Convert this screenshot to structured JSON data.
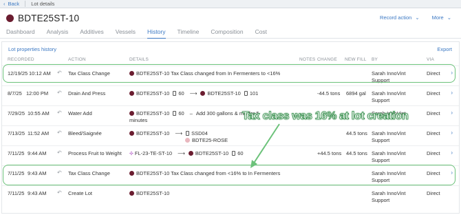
{
  "topbar": {
    "back_label": "Back",
    "breadcrumb": "Lot details"
  },
  "lot": {
    "name": "BDTE25ST-10",
    "color": "#6b1d30"
  },
  "actions": {
    "record_action": "Record action",
    "more": "More"
  },
  "tabs": [
    "Dashboard",
    "Analysis",
    "Additives",
    "Vessels",
    "History",
    "Timeline",
    "Composition",
    "Cost"
  ],
  "active_tab": "History",
  "section": {
    "title": "Lot properties history",
    "export": "Export"
  },
  "columns": {
    "recorded": "RECORDED",
    "action": "ACTION",
    "details": "DETAILS",
    "notes": "NOTES",
    "change": "CHANGE",
    "new_fill": "NEW FILL",
    "by": "BY",
    "via": "VIA"
  },
  "rows": [
    {
      "date": "12/19/25",
      "time": "10:12 AM",
      "action": "Tax Class Change",
      "details": "BDTE25ST-10 Tax Class changed from In Fermenters to <16%",
      "change": "",
      "new_fill": "",
      "by": "Sarah InnoVint Support",
      "via": "Direct"
    },
    {
      "date": "8/7/25",
      "time": "12:00 PM",
      "action": "Drain And Press",
      "from_lot": "BDTE25ST-10",
      "from_vessel": "60",
      "to_lot": "BDTE25ST-10",
      "to_vessel": "101",
      "change": "-44.5 tons",
      "new_fill": "6894 gal",
      "by": "Sarah InnoVint Support",
      "via": "Direct"
    },
    {
      "date": "7/29/25",
      "time": "10:55 AM",
      "action": "Water Add",
      "lot": "BDTE25ST-10",
      "vessel": "60",
      "note": "Add 300 gallons & mix for 5",
      "note_cont": "minutes",
      "change": "",
      "new_fill": "",
      "by": "Sarah InnoVint",
      "via": "Direct"
    },
    {
      "date": "7/13/25",
      "time": "11:52 AM",
      "action": "Bleed/Saignée",
      "from_lot": "BDTE25ST-10",
      "to_vessel": "SSD04",
      "to_lot": "BDTE25-ROSE",
      "change": "",
      "new_fill": "44.5 tons",
      "by": "Sarah InnoVint Support",
      "via": "Direct"
    },
    {
      "date": "7/11/25",
      "time": "9:44 AM",
      "action": "Process Fruit to Weight",
      "from_lot": "FL-23-TE-ST-10",
      "to_lot": "BDTE25ST-10",
      "to_vessel": "60",
      "change": "+44.5 tons",
      "new_fill": "44.5 tons",
      "by": "Sarah InnoVint Support",
      "via": "Direct"
    },
    {
      "date": "7/11/25",
      "time": "9:43 AM",
      "action": "Tax Class Change",
      "details": "BDTE25ST-10 Tax Class changed from <16% to In Fermenters",
      "change": "",
      "new_fill": "",
      "by": "Sarah InnoVint Support",
      "via": "Direct"
    },
    {
      "date": "7/11/25",
      "time": "9:43 AM",
      "action": "Create Lot",
      "details": "BDTE25ST-10",
      "change": "",
      "new_fill": "",
      "by": "Sarah InnoVint Support",
      "via": "Direct"
    }
  ],
  "annotation": "Tax class was 16% at lot creation",
  "colors": {
    "accent": "#3b78c3",
    "highlight": "#6cc27a",
    "lot": "#6b1d30"
  }
}
